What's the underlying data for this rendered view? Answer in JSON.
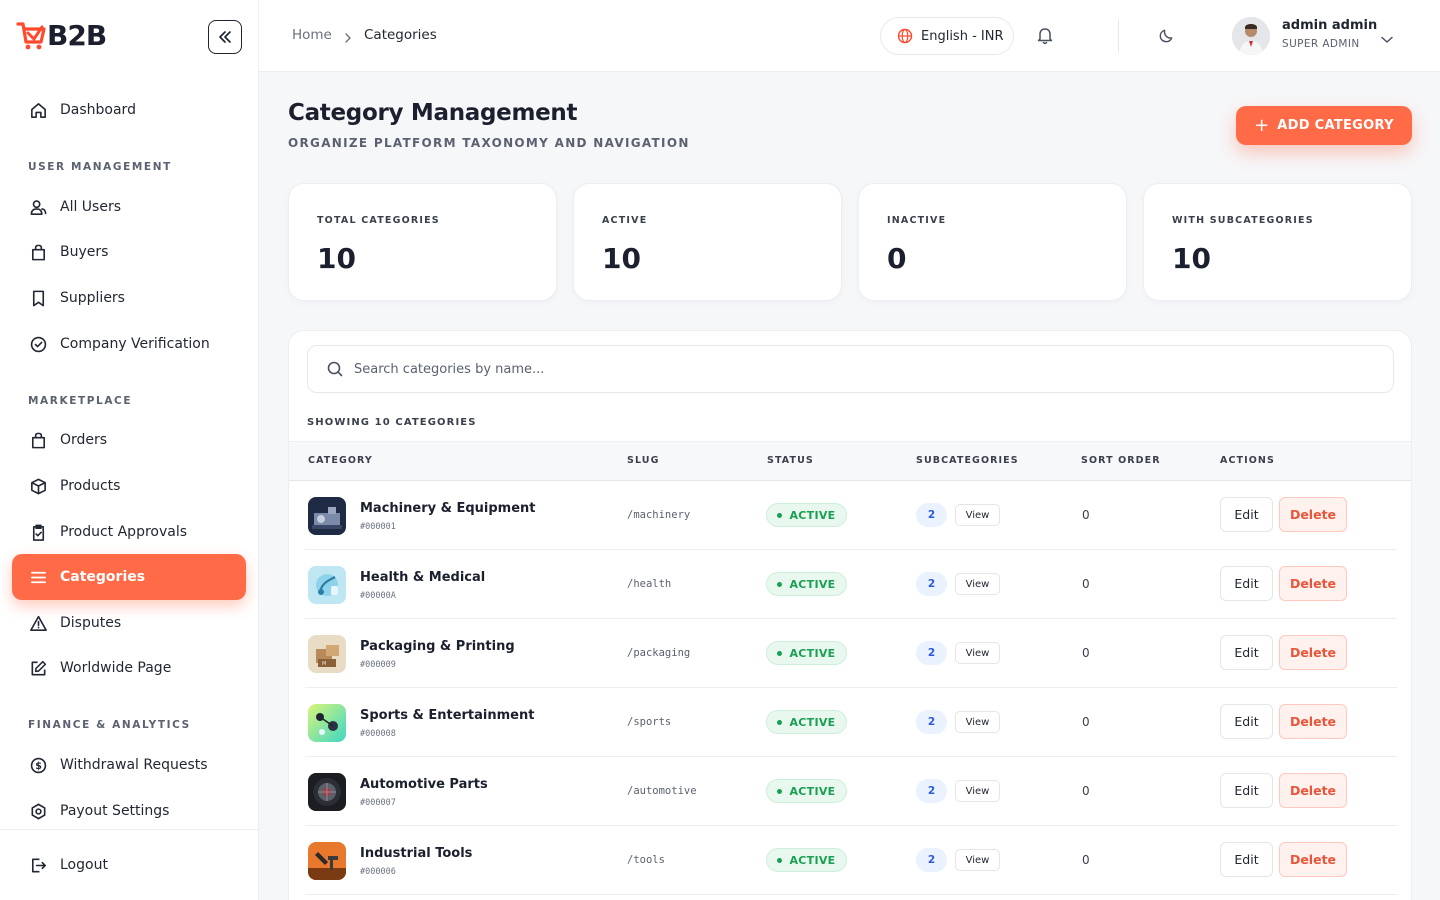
{
  "brand": {
    "name": "B2B",
    "accent": "#ff6a47"
  },
  "sidebar": {
    "dashboard": "Dashboard",
    "sections": {
      "user_management": "USER MANAGEMENT",
      "marketplace": "MARKETPLACE",
      "finance": "FINANCE & ANALYTICS"
    },
    "items": {
      "all_users": "All Users",
      "buyers": "Buyers",
      "suppliers": "Suppliers",
      "company_verification": "Company Verification",
      "orders": "Orders",
      "products": "Products",
      "product_approvals": "Product Approvals",
      "categories": "Categories",
      "disputes": "Disputes",
      "worldwide_page": "Worldwide Page",
      "withdrawal_requests": "Withdrawal Requests",
      "payout_settings": "Payout Settings"
    },
    "logout": "Logout"
  },
  "topbar": {
    "breadcrumb_home": "Home",
    "breadcrumb_current": "Categories",
    "language": "English - INR",
    "user_name": "admin admin",
    "user_role": "SUPER ADMIN"
  },
  "header": {
    "title": "Category Management",
    "subtitle": "ORGANIZE PLATFORM TAXONOMY AND NAVIGATION",
    "add_button": "ADD CATEGORY"
  },
  "stats": [
    {
      "label": "TOTAL CATEGORIES",
      "value": "10"
    },
    {
      "label": "ACTIVE",
      "value": "10"
    },
    {
      "label": "INACTIVE",
      "value": "0"
    },
    {
      "label": "WITH SUBCATEGORIES",
      "value": "10"
    }
  ],
  "table": {
    "search_placeholder": "Search categories by name...",
    "showing": "SHOWING 10 CATEGORIES",
    "columns": {
      "category": "CATEGORY",
      "slug": "SLUG",
      "status": "STATUS",
      "subcategories": "SUBCATEGORIES",
      "sort_order": "SORT ORDER",
      "actions": "ACTIONS"
    },
    "rows": [
      {
        "name": "Machinery & Equipment",
        "id": "#000001",
        "slug": "/machinery",
        "status": "ACTIVE",
        "subcategories": "2",
        "view": "View",
        "sort": "0",
        "edit": "Edit",
        "delete": "Delete"
      },
      {
        "name": "Health & Medical",
        "id": "#00000A",
        "slug": "/health",
        "status": "ACTIVE",
        "subcategories": "2",
        "view": "View",
        "sort": "0",
        "edit": "Edit",
        "delete": "Delete"
      },
      {
        "name": "Packaging & Printing",
        "id": "#000009",
        "slug": "/packaging",
        "status": "ACTIVE",
        "subcategories": "2",
        "view": "View",
        "sort": "0",
        "edit": "Edit",
        "delete": "Delete"
      },
      {
        "name": "Sports & Entertainment",
        "id": "#000008",
        "slug": "/sports",
        "status": "ACTIVE",
        "subcategories": "2",
        "view": "View",
        "sort": "0",
        "edit": "Edit",
        "delete": "Delete"
      },
      {
        "name": "Automotive Parts",
        "id": "#000007",
        "slug": "/automotive",
        "status": "ACTIVE",
        "subcategories": "2",
        "view": "View",
        "sort": "0",
        "edit": "Edit",
        "delete": "Delete"
      },
      {
        "name": "Industrial Tools",
        "id": "#000006",
        "slug": "/tools",
        "status": "ACTIVE",
        "subcategories": "2",
        "view": "View",
        "sort": "0",
        "edit": "Edit",
        "delete": "Delete"
      }
    ]
  }
}
